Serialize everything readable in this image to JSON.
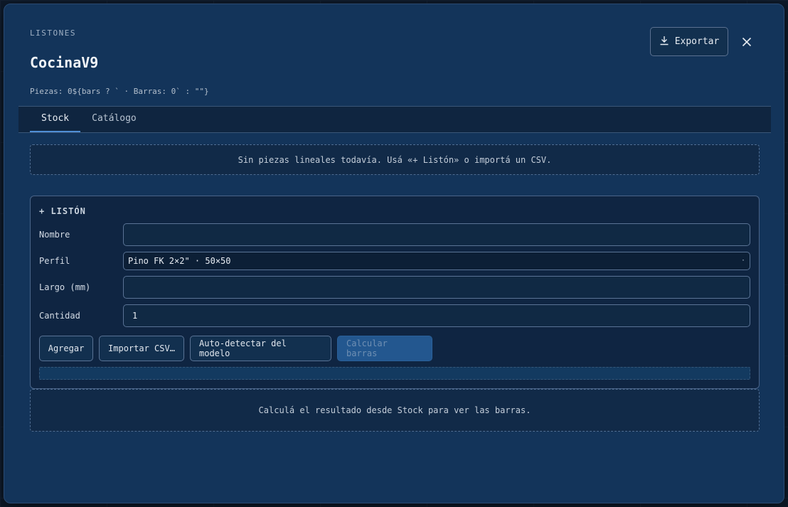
{
  "header": {
    "eyebrow": "LISTONES",
    "title": "CocinaV9",
    "subtitle": "Piezas: 0${bars ? ` · Barras: 0` : \"\"}",
    "export_label": "Exportar"
  },
  "tabs": [
    {
      "label": "Stock",
      "active": true
    },
    {
      "label": "Catálogo",
      "active": false
    }
  ],
  "stock": {
    "empty_message": "Sin piezas lineales todavía. Usá «+ Listón» o importá un CSV.",
    "form": {
      "heading": "+ LISTÓN",
      "nombre_label": "Nombre",
      "nombre_value": "",
      "perfil_label": "Perfil",
      "perfil_value": "Pino FK 2×2\" · 50×50",
      "largo_label": "Largo (mm)",
      "largo_value": "",
      "cantidad_label": "Cantidad",
      "cantidad_value": "1"
    },
    "actions": {
      "agregar": "Agregar",
      "importar": "Importar CSV…",
      "autodetectar": "Auto-detectar del modelo",
      "calcular": "Calcular barras"
    },
    "result_message": "Calculá el resultado desde Stock para ver las barras."
  },
  "icons": {
    "export": "download-icon",
    "close": "close-icon",
    "select": "chevron-down-icon"
  },
  "colors": {
    "modal_bg": "#13345a",
    "accent": "#4f8fd6",
    "disabled_button": "#23578f"
  }
}
